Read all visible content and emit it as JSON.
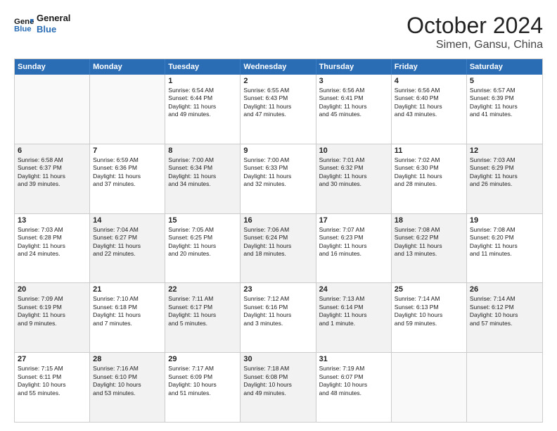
{
  "header": {
    "logo_line1": "General",
    "logo_line2": "Blue",
    "title": "October 2024",
    "subtitle": "Simen, Gansu, China"
  },
  "days_of_week": [
    "Sunday",
    "Monday",
    "Tuesday",
    "Wednesday",
    "Thursday",
    "Friday",
    "Saturday"
  ],
  "rows": [
    [
      {
        "num": "",
        "lines": [],
        "empty": true
      },
      {
        "num": "",
        "lines": [],
        "empty": true
      },
      {
        "num": "1",
        "lines": [
          "Sunrise: 6:54 AM",
          "Sunset: 6:44 PM",
          "Daylight: 11 hours",
          "and 49 minutes."
        ]
      },
      {
        "num": "2",
        "lines": [
          "Sunrise: 6:55 AM",
          "Sunset: 6:43 PM",
          "Daylight: 11 hours",
          "and 47 minutes."
        ]
      },
      {
        "num": "3",
        "lines": [
          "Sunrise: 6:56 AM",
          "Sunset: 6:41 PM",
          "Daylight: 11 hours",
          "and 45 minutes."
        ]
      },
      {
        "num": "4",
        "lines": [
          "Sunrise: 6:56 AM",
          "Sunset: 6:40 PM",
          "Daylight: 11 hours",
          "and 43 minutes."
        ]
      },
      {
        "num": "5",
        "lines": [
          "Sunrise: 6:57 AM",
          "Sunset: 6:39 PM",
          "Daylight: 11 hours",
          "and 41 minutes."
        ]
      }
    ],
    [
      {
        "num": "6",
        "lines": [
          "Sunrise: 6:58 AM",
          "Sunset: 6:37 PM",
          "Daylight: 11 hours",
          "and 39 minutes."
        ],
        "shaded": true
      },
      {
        "num": "7",
        "lines": [
          "Sunrise: 6:59 AM",
          "Sunset: 6:36 PM",
          "Daylight: 11 hours",
          "and 37 minutes."
        ]
      },
      {
        "num": "8",
        "lines": [
          "Sunrise: 7:00 AM",
          "Sunset: 6:34 PM",
          "Daylight: 11 hours",
          "and 34 minutes."
        ],
        "shaded": true
      },
      {
        "num": "9",
        "lines": [
          "Sunrise: 7:00 AM",
          "Sunset: 6:33 PM",
          "Daylight: 11 hours",
          "and 32 minutes."
        ]
      },
      {
        "num": "10",
        "lines": [
          "Sunrise: 7:01 AM",
          "Sunset: 6:32 PM",
          "Daylight: 11 hours",
          "and 30 minutes."
        ],
        "shaded": true
      },
      {
        "num": "11",
        "lines": [
          "Sunrise: 7:02 AM",
          "Sunset: 6:30 PM",
          "Daylight: 11 hours",
          "and 28 minutes."
        ]
      },
      {
        "num": "12",
        "lines": [
          "Sunrise: 7:03 AM",
          "Sunset: 6:29 PM",
          "Daylight: 11 hours",
          "and 26 minutes."
        ],
        "shaded": true
      }
    ],
    [
      {
        "num": "13",
        "lines": [
          "Sunrise: 7:03 AM",
          "Sunset: 6:28 PM",
          "Daylight: 11 hours",
          "and 24 minutes."
        ]
      },
      {
        "num": "14",
        "lines": [
          "Sunrise: 7:04 AM",
          "Sunset: 6:27 PM",
          "Daylight: 11 hours",
          "and 22 minutes."
        ],
        "shaded": true
      },
      {
        "num": "15",
        "lines": [
          "Sunrise: 7:05 AM",
          "Sunset: 6:25 PM",
          "Daylight: 11 hours",
          "and 20 minutes."
        ]
      },
      {
        "num": "16",
        "lines": [
          "Sunrise: 7:06 AM",
          "Sunset: 6:24 PM",
          "Daylight: 11 hours",
          "and 18 minutes."
        ],
        "shaded": true
      },
      {
        "num": "17",
        "lines": [
          "Sunrise: 7:07 AM",
          "Sunset: 6:23 PM",
          "Daylight: 11 hours",
          "and 16 minutes."
        ]
      },
      {
        "num": "18",
        "lines": [
          "Sunrise: 7:08 AM",
          "Sunset: 6:22 PM",
          "Daylight: 11 hours",
          "and 13 minutes."
        ],
        "shaded": true
      },
      {
        "num": "19",
        "lines": [
          "Sunrise: 7:08 AM",
          "Sunset: 6:20 PM",
          "Daylight: 11 hours",
          "and 11 minutes."
        ]
      }
    ],
    [
      {
        "num": "20",
        "lines": [
          "Sunrise: 7:09 AM",
          "Sunset: 6:19 PM",
          "Daylight: 11 hours",
          "and 9 minutes."
        ],
        "shaded": true
      },
      {
        "num": "21",
        "lines": [
          "Sunrise: 7:10 AM",
          "Sunset: 6:18 PM",
          "Daylight: 11 hours",
          "and 7 minutes."
        ]
      },
      {
        "num": "22",
        "lines": [
          "Sunrise: 7:11 AM",
          "Sunset: 6:17 PM",
          "Daylight: 11 hours",
          "and 5 minutes."
        ],
        "shaded": true
      },
      {
        "num": "23",
        "lines": [
          "Sunrise: 7:12 AM",
          "Sunset: 6:16 PM",
          "Daylight: 11 hours",
          "and 3 minutes."
        ]
      },
      {
        "num": "24",
        "lines": [
          "Sunrise: 7:13 AM",
          "Sunset: 6:14 PM",
          "Daylight: 11 hours",
          "and 1 minute."
        ],
        "shaded": true
      },
      {
        "num": "25",
        "lines": [
          "Sunrise: 7:14 AM",
          "Sunset: 6:13 PM",
          "Daylight: 10 hours",
          "and 59 minutes."
        ]
      },
      {
        "num": "26",
        "lines": [
          "Sunrise: 7:14 AM",
          "Sunset: 6:12 PM",
          "Daylight: 10 hours",
          "and 57 minutes."
        ],
        "shaded": true
      }
    ],
    [
      {
        "num": "27",
        "lines": [
          "Sunrise: 7:15 AM",
          "Sunset: 6:11 PM",
          "Daylight: 10 hours",
          "and 55 minutes."
        ]
      },
      {
        "num": "28",
        "lines": [
          "Sunrise: 7:16 AM",
          "Sunset: 6:10 PM",
          "Daylight: 10 hours",
          "and 53 minutes."
        ],
        "shaded": true
      },
      {
        "num": "29",
        "lines": [
          "Sunrise: 7:17 AM",
          "Sunset: 6:09 PM",
          "Daylight: 10 hours",
          "and 51 minutes."
        ]
      },
      {
        "num": "30",
        "lines": [
          "Sunrise: 7:18 AM",
          "Sunset: 6:08 PM",
          "Daylight: 10 hours",
          "and 49 minutes."
        ],
        "shaded": true
      },
      {
        "num": "31",
        "lines": [
          "Sunrise: 7:19 AM",
          "Sunset: 6:07 PM",
          "Daylight: 10 hours",
          "and 48 minutes."
        ]
      },
      {
        "num": "",
        "lines": [],
        "empty": true
      },
      {
        "num": "",
        "lines": [],
        "empty": true
      }
    ]
  ]
}
